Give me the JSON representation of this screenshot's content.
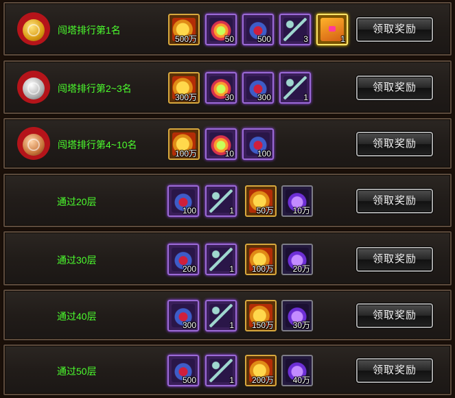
{
  "button_label": "领取奖励",
  "rows": [
    {
      "title": "闯塔排行第1名",
      "medal": "gold",
      "rewards": [
        {
          "icon": "gold-coins-icon",
          "qty": "500万"
        },
        {
          "icon": "green-crystal-icon",
          "qty": "50"
        },
        {
          "icon": "gem-cluster-icon",
          "qty": "500"
        },
        {
          "icon": "silver-key-icon",
          "qty": "3"
        },
        {
          "icon": "treasure-chest-icon",
          "qty": "1"
        }
      ]
    },
    {
      "title": "闯塔排行第2~3名",
      "medal": "silver",
      "rewards": [
        {
          "icon": "gold-coins-icon",
          "qty": "300万"
        },
        {
          "icon": "green-crystal-icon",
          "qty": "30"
        },
        {
          "icon": "gem-cluster-icon",
          "qty": "300"
        },
        {
          "icon": "silver-key-icon",
          "qty": "1"
        }
      ]
    },
    {
      "title": "闯塔排行第4~10名",
      "medal": "bronze",
      "rewards": [
        {
          "icon": "gold-coins-icon",
          "qty": "100万"
        },
        {
          "icon": "green-crystal-icon",
          "qty": "10"
        },
        {
          "icon": "gem-cluster-icon",
          "qty": "100"
        }
      ]
    },
    {
      "title": "通过20层",
      "medal": null,
      "rewards": [
        {
          "icon": "gem-cluster-icon",
          "qty": "100"
        },
        {
          "icon": "silver-key-icon",
          "qty": "1"
        },
        {
          "icon": "gold-coins-icon",
          "qty": "50万"
        },
        {
          "icon": "purple-shard-icon",
          "qty": "10万"
        }
      ]
    },
    {
      "title": "通过30层",
      "medal": null,
      "rewards": [
        {
          "icon": "gem-cluster-icon",
          "qty": "200"
        },
        {
          "icon": "silver-key-icon",
          "qty": "1"
        },
        {
          "icon": "gold-coins-icon",
          "qty": "100万"
        },
        {
          "icon": "purple-shard-icon",
          "qty": "20万"
        }
      ]
    },
    {
      "title": "通过40层",
      "medal": null,
      "rewards": [
        {
          "icon": "gem-cluster-icon",
          "qty": "300"
        },
        {
          "icon": "silver-key-icon",
          "qty": "1"
        },
        {
          "icon": "gold-coins-icon",
          "qty": "150万"
        },
        {
          "icon": "purple-shard-icon",
          "qty": "30万"
        }
      ]
    },
    {
      "title": "通过50层",
      "medal": null,
      "rewards": [
        {
          "icon": "gem-cluster-icon",
          "qty": "500"
        },
        {
          "icon": "silver-key-icon",
          "qty": "1"
        },
        {
          "icon": "gold-coins-icon",
          "qty": "200万"
        },
        {
          "icon": "purple-shard-icon",
          "qty": "40万"
        }
      ]
    }
  ]
}
